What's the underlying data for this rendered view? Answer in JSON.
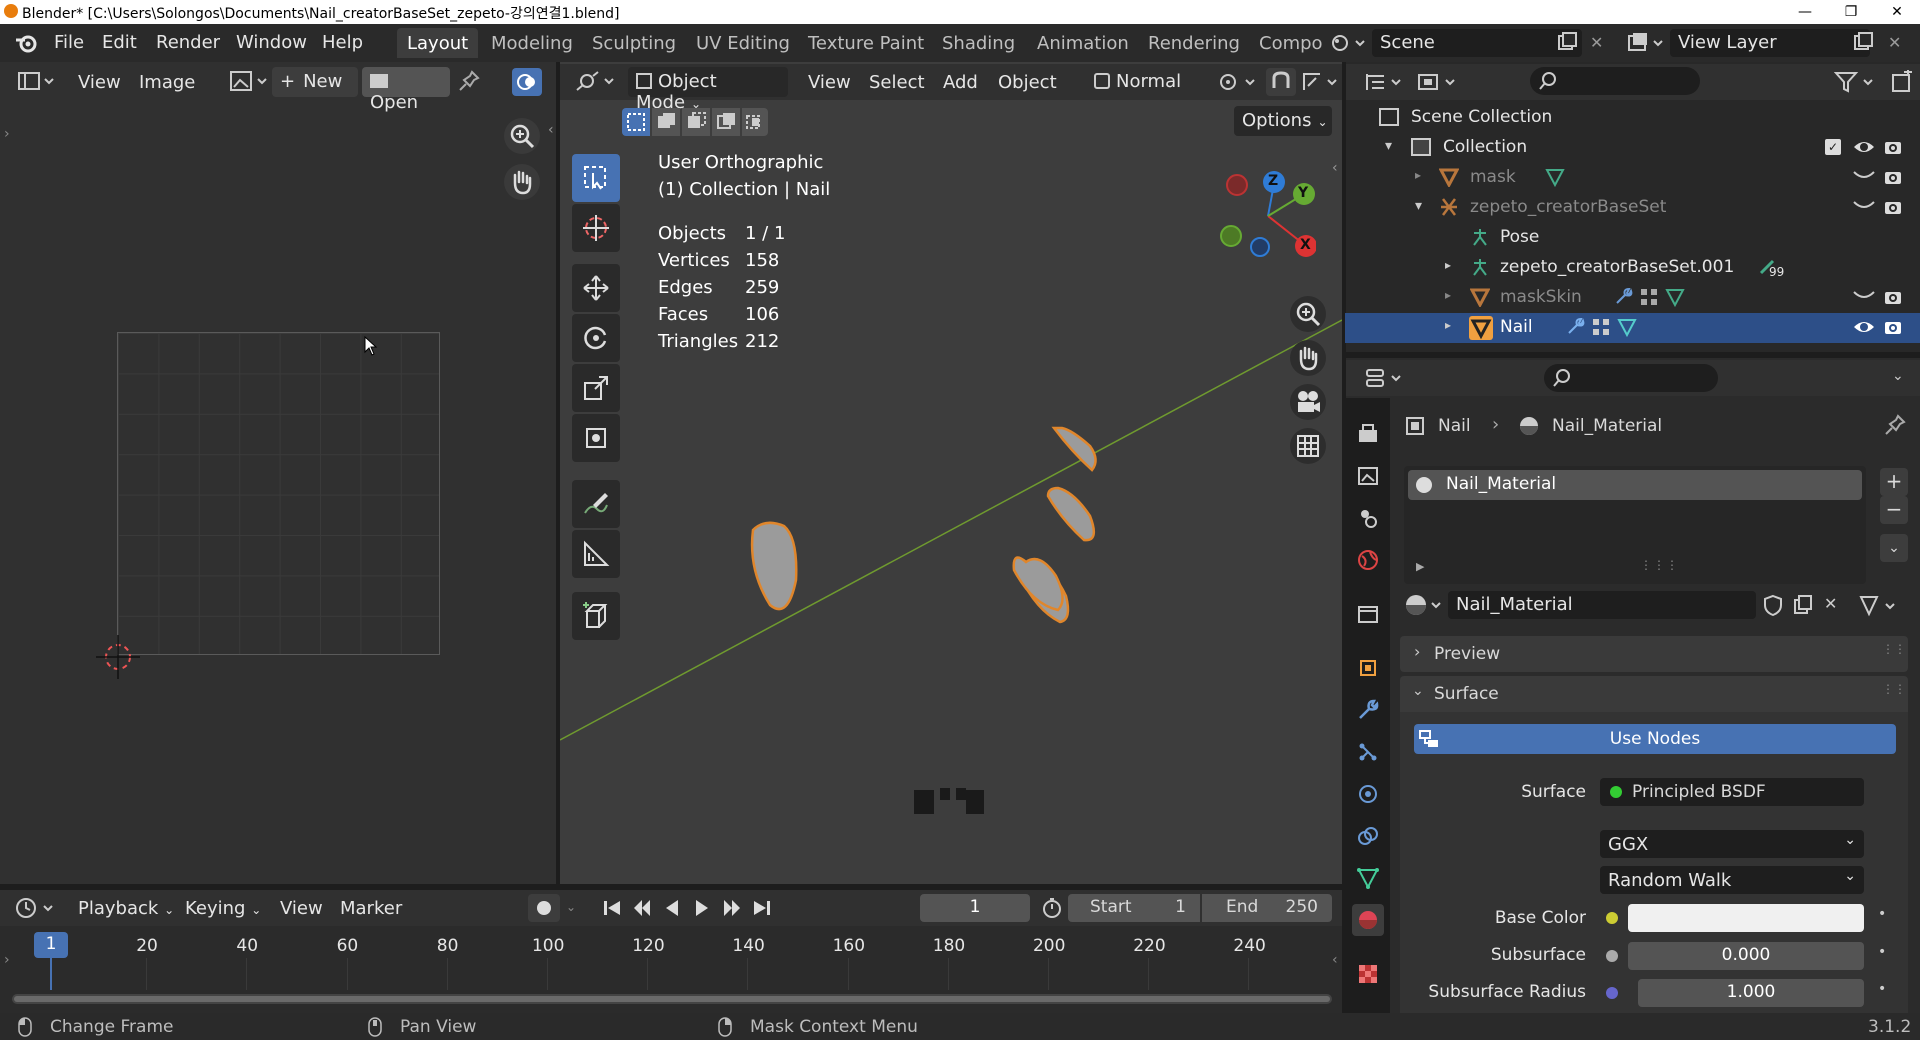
{
  "window": {
    "title": "Blender* [C:\\Users\\Solongos\\Documents\\Nail_creatorBaseSet_zepeto-강의연결1.blend]",
    "minimize": "—",
    "maximize": "❐",
    "close": "✕"
  },
  "menu": [
    "File",
    "Edit",
    "Render",
    "Window",
    "Help"
  ],
  "workspaces": [
    "Layout",
    "Modeling",
    "Sculpting",
    "UV Editing",
    "Texture Paint",
    "Shading",
    "Animation",
    "Rendering",
    "Compo"
  ],
  "scene": {
    "label": "Scene"
  },
  "view_layer": {
    "label": "View Layer"
  },
  "image_editor": {
    "view": "View",
    "image": "Image",
    "new": "New",
    "open": "Open"
  },
  "viewport": {
    "mode": "Object Mode",
    "view": "View",
    "select": "Select",
    "add": "Add",
    "object": "Object",
    "orientation": "Normal",
    "options": "Options",
    "title": "User Orthographic",
    "subtitle": "(1) Collection | Nail",
    "stats": [
      {
        "label": "Objects",
        "value": "1 / 1"
      },
      {
        "label": "Vertices",
        "value": "158"
      },
      {
        "label": "Edges",
        "value": "259"
      },
      {
        "label": "Faces",
        "value": "106"
      },
      {
        "label": "Triangles",
        "value": "212"
      }
    ],
    "gizmo": {
      "z": "Z",
      "y": "Y",
      "x": "X"
    }
  },
  "outliner": {
    "rows": [
      {
        "label": "Scene Collection"
      },
      {
        "label": "Collection"
      },
      {
        "label": "mask"
      },
      {
        "label": "zepeto_creatorBaseSet"
      },
      {
        "label": "Pose"
      },
      {
        "label": "zepeto_creatorBaseSet.001",
        "badge": "99"
      },
      {
        "label": "maskSkin"
      },
      {
        "label": "Nail"
      }
    ]
  },
  "properties": {
    "breadcrumb": {
      "object": "Nail",
      "material": "Nail_Material"
    },
    "slot": "Nail_Material",
    "material_name": "Nail_Material",
    "panels": {
      "preview": "Preview",
      "surface": "Surface"
    },
    "use_nodes": "Use Nodes",
    "surface_label": "Surface",
    "surface_value": "Principled BSDF",
    "distribution": "GGX",
    "subsurface_method": "Random Walk",
    "base_color_label": "Base Color",
    "subsurface_label": "Subsurface",
    "subsurface_value": "0.000",
    "subsurface_radius_label": "Subsurface Radius",
    "subsurface_radius_value": "1.000",
    "colors": {
      "base_color": "#f0f0f0",
      "accent": "#4772b3"
    }
  },
  "timeline": {
    "playback": "Playback",
    "keying": "Keying",
    "view": "View",
    "marker": "Marker",
    "current_frame": "1",
    "start_label": "Start",
    "start_value": "1",
    "end_label": "End",
    "end_value": "250",
    "playhead": "1",
    "ticks": [
      "20",
      "40",
      "60",
      "80",
      "100",
      "120",
      "140",
      "160",
      "180",
      "200",
      "220",
      "240"
    ]
  },
  "status": {
    "change_frame": "Change Frame",
    "pan_view": "Pan View",
    "context_menu": "Mask Context Menu",
    "version": "3.1.2"
  }
}
